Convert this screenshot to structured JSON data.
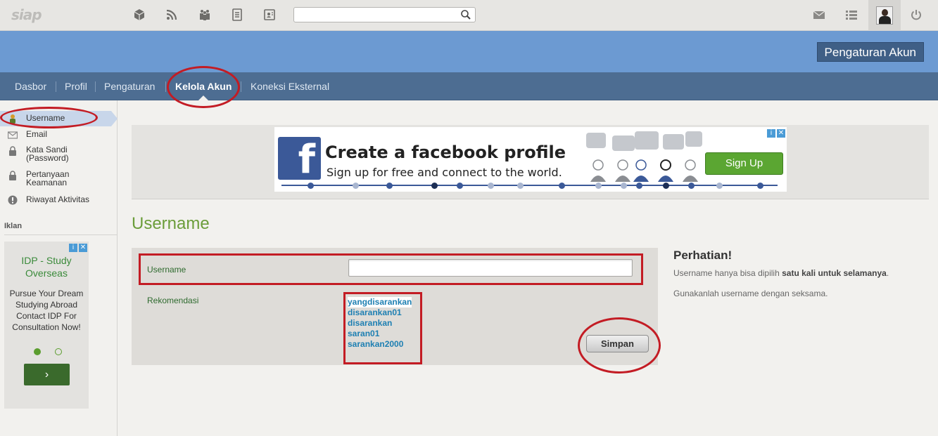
{
  "app": {
    "logo_text": "siap"
  },
  "topbar": {
    "icons": [
      "cube-icon",
      "rss-icon",
      "group-icon",
      "document-icon",
      "contact-card-icon"
    ],
    "search_placeholder": "",
    "right_icons": [
      "mail-icon",
      "list-icon",
      "power-icon"
    ]
  },
  "header": {
    "account_button": "Pengaturan Akun"
  },
  "nav": {
    "items": [
      {
        "label": "Dasbor"
      },
      {
        "label": "Profil"
      },
      {
        "label": "Pengaturan"
      },
      {
        "label": "Kelola Akun",
        "active": true
      },
      {
        "label": "Koneksi Eksternal"
      }
    ]
  },
  "sidebar": {
    "items": [
      {
        "label": "Username",
        "icon": "user-icon",
        "selected": true
      },
      {
        "label": "Email",
        "icon": "envelope-icon"
      },
      {
        "label": "Kata Sandi (Password)",
        "line1": "Kata Sandi",
        "line2": "(Password)",
        "icon": "lock-icon"
      },
      {
        "label": "Pertanyaan Keamanan",
        "line1": "Pertanyaan",
        "line2": "Keamanan",
        "icon": "lock-icon"
      },
      {
        "label": "Riwayat Aktivitas",
        "icon": "alert-icon"
      }
    ],
    "ads_heading": "Iklan",
    "ad": {
      "title_line1": "IDP - Study",
      "title_line2": "Overseas",
      "body_lines": [
        "Pursue Your Dream",
        "Studying Abroad",
        "Contact IDP For",
        "Consultation Now!"
      ],
      "button_glyph": "›"
    }
  },
  "banner": {
    "logo_letter": "f",
    "title": "Create a facebook profile",
    "subtitle": "Sign up for free and connect to the world.",
    "button": "Sign Up"
  },
  "main": {
    "heading": "Username",
    "form": {
      "username_label": "Username",
      "username_value": "",
      "recommendation_label": "Rekomendasi",
      "recommendations": [
        "yangdisarankan",
        "disarankan01",
        "disarankan",
        "saran01",
        "sarankan2000"
      ],
      "save_button": "Simpan"
    },
    "notice": {
      "title": "Perhatian!",
      "line1_prefix": "Username hanya bisa dipilih ",
      "line1_bold": "satu kali untuk selamanya",
      "line1_suffix": ".",
      "line2": "Gunakanlah username dengan seksama."
    }
  },
  "colors": {
    "header_blue": "#6c9ad2",
    "nav_blue": "#4d6d92",
    "heading_green": "#6b9d3a",
    "link_blue": "#1d7fb2",
    "annotation_red": "#c31c24",
    "facebook_blue": "#3b5998",
    "signup_green": "#5ba632"
  }
}
